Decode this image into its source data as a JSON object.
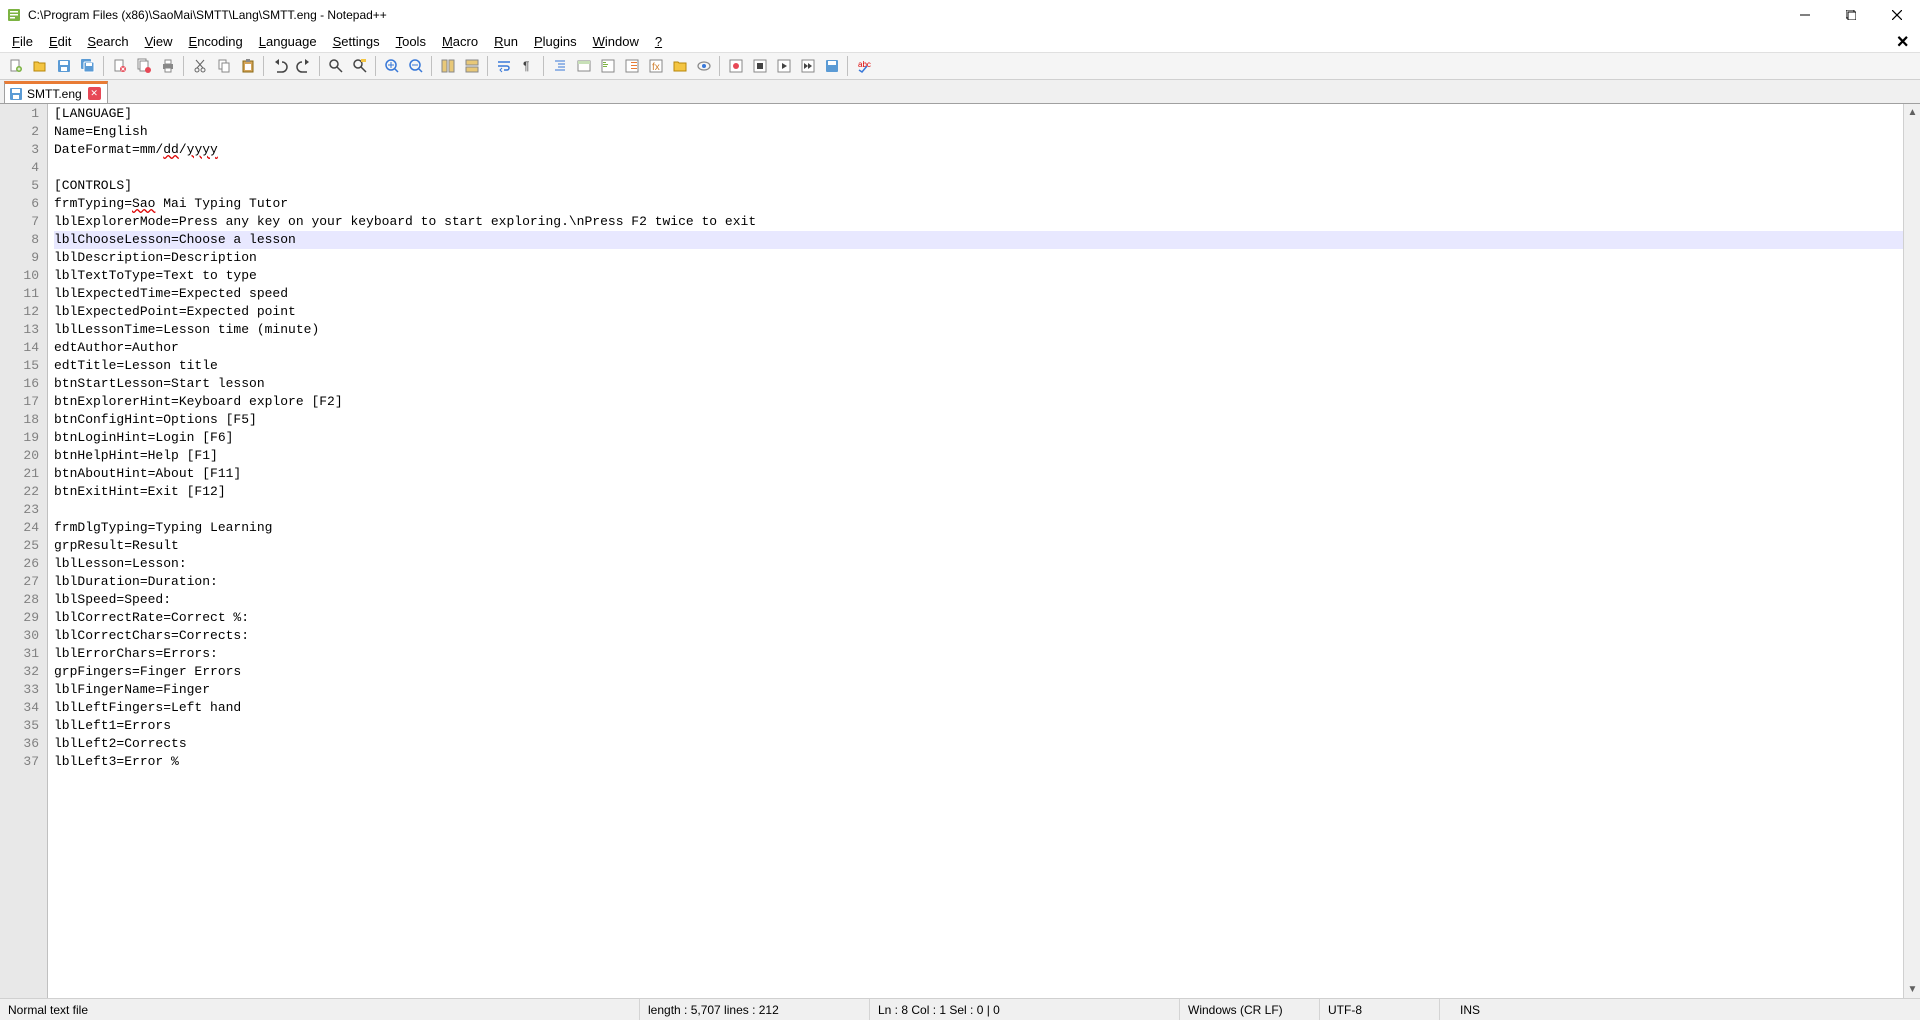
{
  "title": "C:\\Program Files (x86)\\SaoMai\\SMTT\\Lang\\SMTT.eng - Notepad++",
  "menu": [
    "File",
    "Edit",
    "Search",
    "View",
    "Encoding",
    "Language",
    "Settings",
    "Tools",
    "Macro",
    "Run",
    "Plugins",
    "Window",
    "?"
  ],
  "tab": {
    "name": "SMTT.eng"
  },
  "hl_line": 8,
  "lines": [
    "[LANGUAGE]",
    "Name=English",
    "DateFormat=mm/dd/yyyy",
    "",
    "[CONTROLS]",
    "frmTyping=Sao Mai Typing Tutor",
    "lblExplorerMode=Press any key on your keyboard to start exploring.\\nPress F2 twice to exit",
    "lblChooseLesson=Choose a lesson",
    "lblDescription=Description",
    "lblTextToType=Text to type",
    "lblExpectedTime=Expected speed",
    "lblExpectedPoint=Expected point",
    "lblLessonTime=Lesson time (minute)",
    "edtAuthor=Author",
    "edtTitle=Lesson title",
    "btnStartLesson=Start lesson",
    "btnExplorerHint=Keyboard explore [F2]",
    "btnConfigHint=Options [F5]",
    "btnLoginHint=Login [F6]",
    "btnHelpHint=Help [F1]",
    "btnAboutHint=About [F11]",
    "btnExitHint=Exit [F12]",
    "",
    "frmDlgTyping=Typing Learning",
    "grpResult=Result",
    "lblLesson=Lesson:",
    "lblDuration=Duration:",
    "lblSpeed=Speed:",
    "lblCorrectRate=Correct %:",
    "lblCorrectChars=Corrects:",
    "lblErrorChars=Errors:",
    "grpFingers=Finger Errors",
    "lblFingerName=Finger",
    "lblLeftFingers=Left hand",
    "lblLeft1=Errors",
    "lblLeft2=Corrects",
    "lblLeft3=Error %"
  ],
  "wavy_words": {
    "3": [
      "dd",
      "yyyy"
    ],
    "6": [
      "Sao"
    ]
  },
  "status": {
    "filetype": "Normal text file",
    "length": "length : 5,707    lines : 212",
    "pos": "Ln : 8    Col : 1    Sel : 0 | 0",
    "eol": "Windows (CR LF)",
    "enc": "UTF-8",
    "ins": "INS"
  }
}
